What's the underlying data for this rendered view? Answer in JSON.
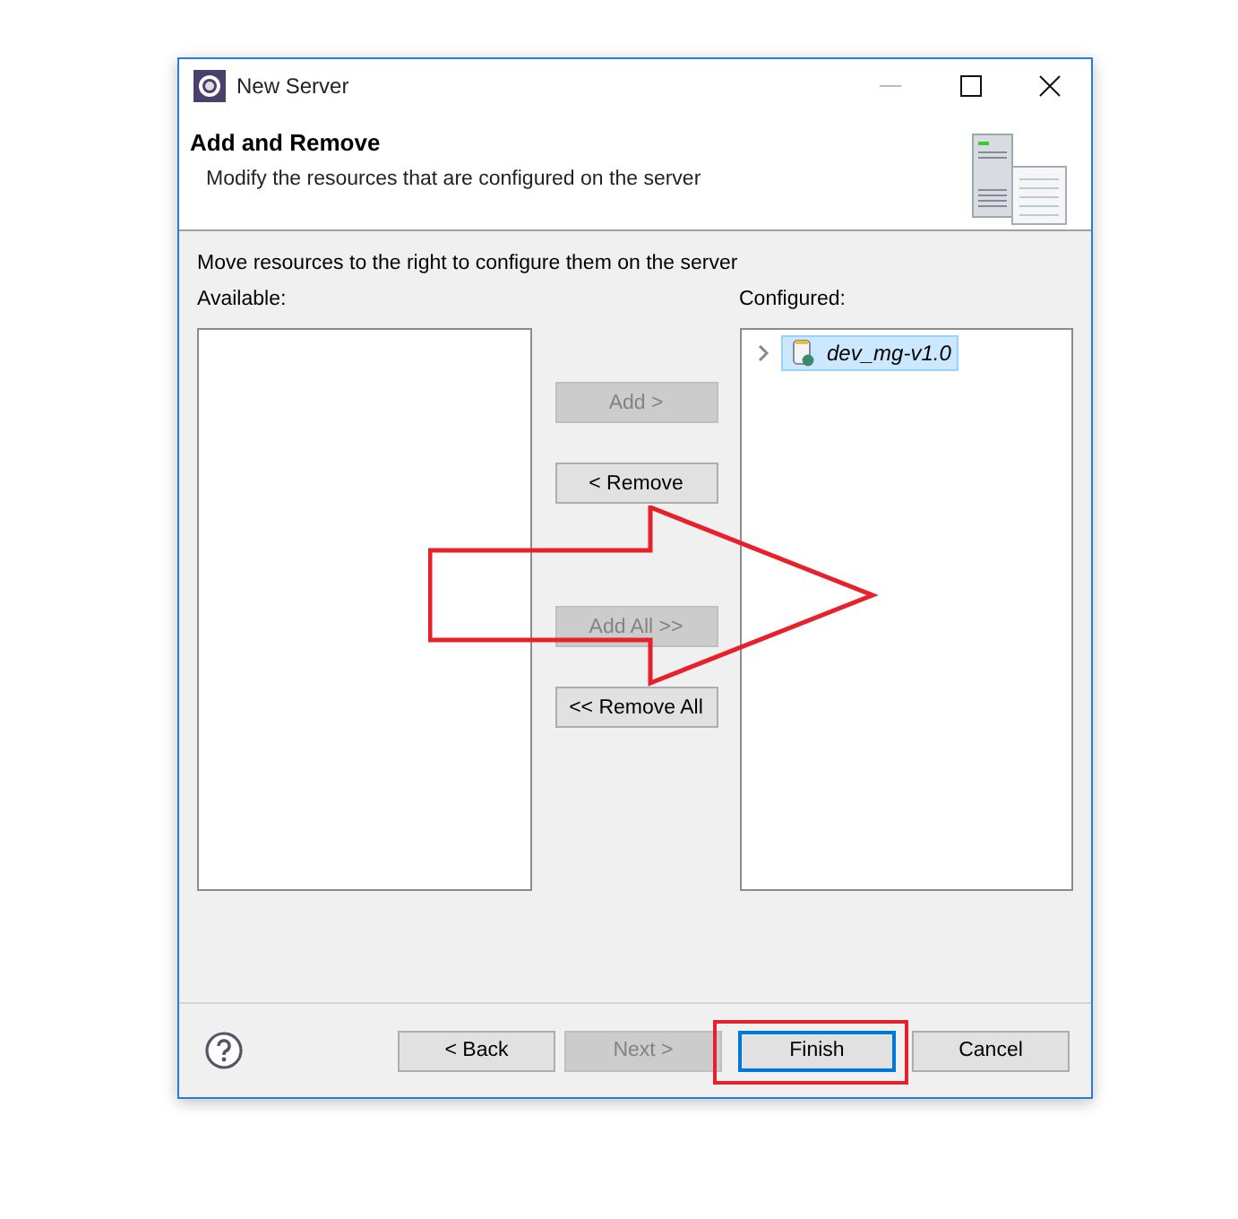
{
  "window": {
    "title": "New Server"
  },
  "header": {
    "title": "Add and Remove",
    "description": "Modify the resources that are configured on the server"
  },
  "instruction": "Move resources to the right to configure them on the server",
  "available": {
    "label": "Available:"
  },
  "move_buttons": [
    {
      "label": "Add >",
      "disabled": true
    },
    {
      "label": "< Remove",
      "disabled": false
    },
    {
      "label": "Add All >>",
      "disabled": true
    },
    {
      "label": "<< Remove All",
      "disabled": false
    }
  ],
  "configured": {
    "label": "Configured:",
    "items": [
      {
        "label": "dev_mg-v1.0",
        "expanded": false,
        "selected": true
      }
    ]
  },
  "footer_buttons": [
    {
      "label": "< Back",
      "disabled": false,
      "focused": false
    },
    {
      "label": "Next >",
      "disabled": true,
      "focused": false
    },
    {
      "label": "Finish",
      "disabled": false,
      "focused": true
    },
    {
      "label": "Cancel",
      "disabled": false,
      "focused": false
    }
  ]
}
